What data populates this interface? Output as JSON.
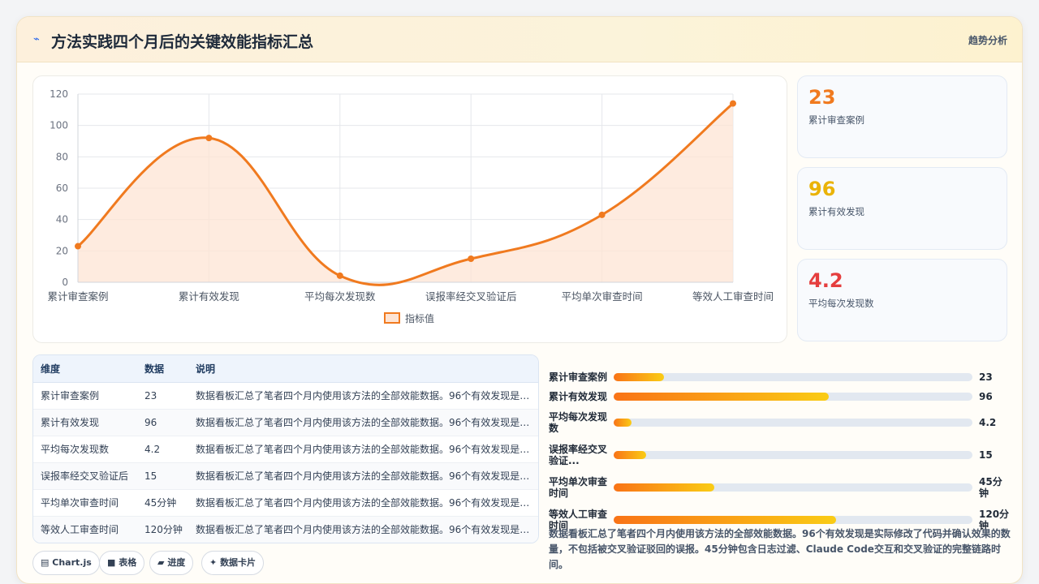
{
  "header": {
    "icon": "sparkline-icon",
    "title": "方法实践四个月后的关键效能指标汇总",
    "trend_label": "趋势分析"
  },
  "colors": {
    "line": "#f07a1f",
    "fill": "#fde4d4",
    "stat1": "#f07a1f",
    "stat2": "#eab308",
    "stat3": "#e53e3e"
  },
  "chart_data": {
    "type": "line",
    "categories": [
      "累计审查案例",
      "累计有效发现",
      "平均每次发现数",
      "误报率经交叉验证后",
      "平均单次审查时间",
      "等效人工审查时间"
    ],
    "series": [
      {
        "name": "指标值",
        "values": [
          23,
          92,
          4.2,
          15,
          43,
          114
        ]
      }
    ],
    "ylim": [
      0,
      120
    ],
    "yticks": [
      0,
      20,
      40,
      60,
      80,
      100,
      120
    ],
    "grid": true,
    "legend": "bottom"
  },
  "stats": [
    {
      "value": "23",
      "label": "累计审查案例"
    },
    {
      "value": "96",
      "label": "累计有效发现"
    },
    {
      "value": "4.2",
      "label": "平均每次发现数"
    }
  ],
  "table": {
    "headers": [
      "维度",
      "数据",
      "说明"
    ],
    "rows": [
      [
        "累计审查案例",
        "23",
        "数据看板汇总了笔者四个月内使用该方法的全部效能数据。96个有效发现是实际修改了代码并确认效果的数量"
      ],
      [
        "累计有效发现",
        "96",
        "数据看板汇总了笔者四个月内使用该方法的全部效能数据。96个有效发现是实际修改了代码并确认效果的数量"
      ],
      [
        "平均每次发现数",
        "4.2",
        "数据看板汇总了笔者四个月内使用该方法的全部效能数据。96个有效发现是实际修改了代码并确认效果的数量"
      ],
      [
        "误报率经交叉验证后",
        "15",
        "数据看板汇总了笔者四个月内使用该方法的全部效能数据。96个有效发现是实际修改了代码并确认效果的数量"
      ],
      [
        "平均单次审查时间",
        "45分钟",
        "数据看板汇总了笔者四个月内使用该方法的全部效能数据。96个有效发现是实际修改了代码并确认效果的数量"
      ],
      [
        "等效人工审查时间",
        "120分钟",
        "数据看板汇总了笔者四个月内使用该方法的全部效能数据。96个有效发现是实际修改了代码并确认效果的数量"
      ]
    ]
  },
  "bars": [
    {
      "label": "累计审查案例",
      "value": "23",
      "fraction": 0.14
    },
    {
      "label": "累计有效发现",
      "value": "96",
      "fraction": 0.6
    },
    {
      "label": "平均每次发现数",
      "value": "4.2",
      "fraction": 0.05
    },
    {
      "label": "误报率经交叉验证...",
      "value": "15",
      "fraction": 0.09
    },
    {
      "label": "平均单次审查时间",
      "value": "45分钟",
      "fraction": 0.28
    },
    {
      "label": "等效人工审查时间",
      "value": "120分钟",
      "fraction": 0.62
    }
  ],
  "note": "数据看板汇总了笔者四个月内使用该方法的全部效能数据。96个有效发现是实际修改了代码并确认效果的数量，不包括被交叉验证驳回的误报。45分钟包含日志过滤、Claude Code交互和交叉验证的完整链路时间。",
  "tabs": [
    {
      "icon": "chart-icon",
      "label": "Chart.js"
    },
    {
      "icon": "table-icon",
      "label": "表格"
    },
    {
      "icon": "progress-icon",
      "label": "进度"
    },
    {
      "icon": "card-icon",
      "label": "数据卡片"
    }
  ]
}
